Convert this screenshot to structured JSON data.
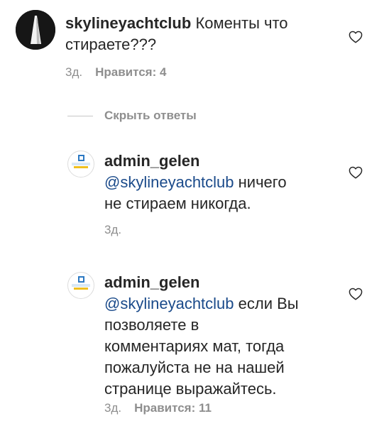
{
  "comment_main": {
    "username": "skylineyachtclub",
    "text_line1": "Коменты что",
    "text_line2": "стираете???",
    "time": "3д.",
    "likes": "Нравится: 4"
  },
  "hide_replies_label": "Скрыть ответы",
  "reply1": {
    "username": "admin_gelen",
    "mention": "@skylineyachtclub",
    "text_line1_rest": " ничего",
    "text_line2": "не стираем никогда.",
    "time": "3д."
  },
  "reply2": {
    "username": "admin_gelen",
    "mention": "@skylineyachtclub",
    "text_line1_rest": " если Вы",
    "text_line2": "позволяете в",
    "text_line3": "комментариях мат, тогда",
    "text_line4": "пожалуйста не на нашей",
    "text_line5": "странице выражайтесь.",
    "time": "3д.",
    "likes": "Нравится: 11"
  },
  "icons": {
    "heart": "heart-outline-icon"
  },
  "colors": {
    "text": "#262626",
    "secondary": "#8e8e8e",
    "mention": "#1a4a8a"
  }
}
